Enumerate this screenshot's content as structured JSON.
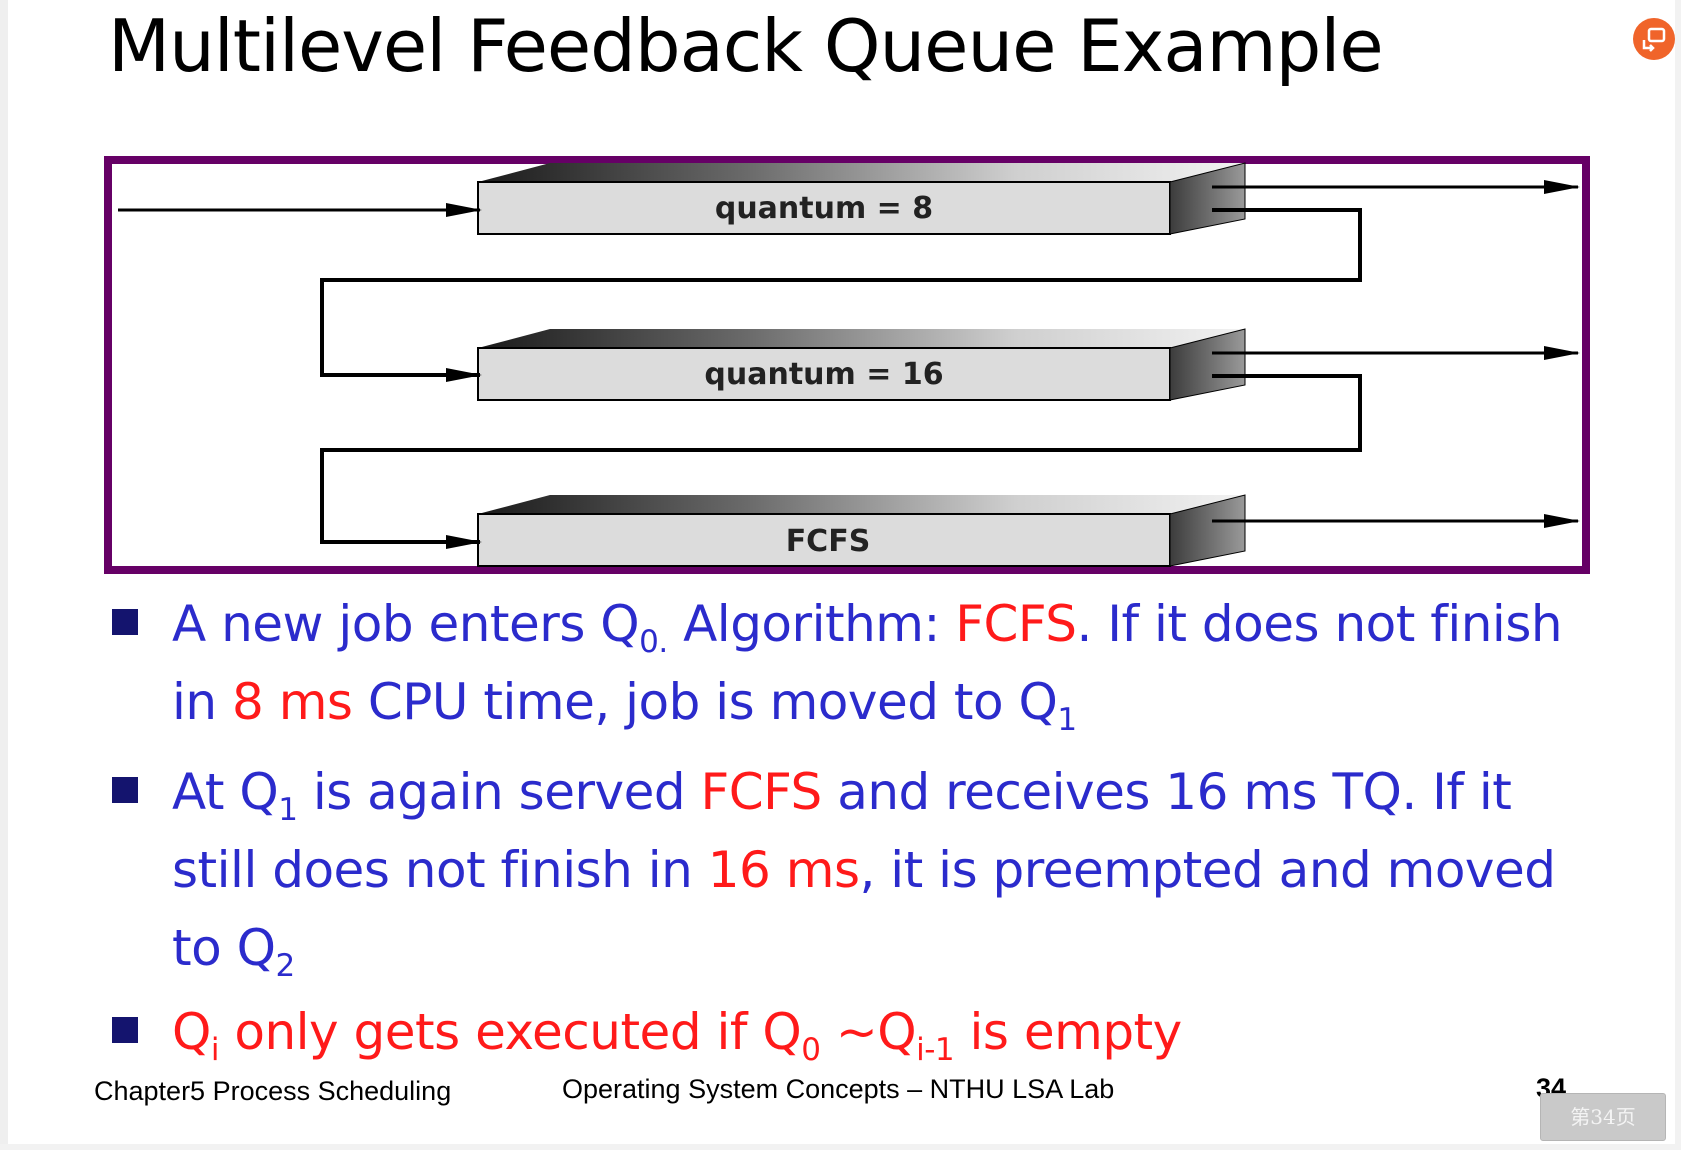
{
  "slide": {
    "title": "Multilevel Feedback Queue Example"
  },
  "diagram": {
    "queues": [
      {
        "label": "quantum = 8"
      },
      {
        "label": "quantum = 16"
      },
      {
        "label": "FCFS"
      }
    ],
    "colors": {
      "frame": "#660066"
    }
  },
  "bullets": [
    {
      "segments": [
        {
          "text": "A new job enters Q",
          "color": "blue"
        },
        {
          "text": "0.",
          "sub": true,
          "color": "blue"
        },
        {
          "text": " Algorithm: ",
          "color": "blue"
        },
        {
          "text": "FCFS",
          "color": "red"
        },
        {
          "text": ". If it does not finish in ",
          "color": "blue"
        },
        {
          "text": "8 ms",
          "color": "red"
        },
        {
          "text": " CPU time, job is moved to Q",
          "color": "blue"
        },
        {
          "text": "1",
          "sub": true,
          "color": "blue"
        }
      ]
    },
    {
      "segments": [
        {
          "text": "At Q",
          "color": "blue"
        },
        {
          "text": "1",
          "sub": true,
          "color": "blue"
        },
        {
          "text": " is again served ",
          "color": "blue"
        },
        {
          "text": "FCFS",
          "color": "red"
        },
        {
          "text": " and receives 16 ms TQ. If it still does not finish in ",
          "color": "blue"
        },
        {
          "text": "16 ms",
          "color": "red"
        },
        {
          "text": ", it is preempted and moved to Q",
          "color": "blue"
        },
        {
          "text": "2",
          "sub": true,
          "color": "blue"
        }
      ]
    },
    {
      "segments": [
        {
          "text": "Q",
          "color": "red"
        },
        {
          "text": "i",
          "sub": true,
          "color": "red"
        },
        {
          "text": " only gets executed if Q",
          "color": "red"
        },
        {
          "text": "0",
          "sub": true,
          "color": "red"
        },
        {
          "text": " ~Q",
          "color": "red"
        },
        {
          "text": "i-1",
          "sub": true,
          "color": "red"
        },
        {
          "text": " is empty",
          "color": "red"
        }
      ]
    }
  ],
  "footer": {
    "chapter": "Chapter5 Process Scheduling",
    "course": "Operating System Concepts – NTHU LSA Lab",
    "page_number": "34"
  },
  "viewer": {
    "page_badge": "第34页",
    "corner_icon": "share-icon"
  },
  "colors": {
    "bullet_text": "#2b2bcc",
    "highlight": "#ff1a1a",
    "bullet_marker": "#14146e"
  }
}
